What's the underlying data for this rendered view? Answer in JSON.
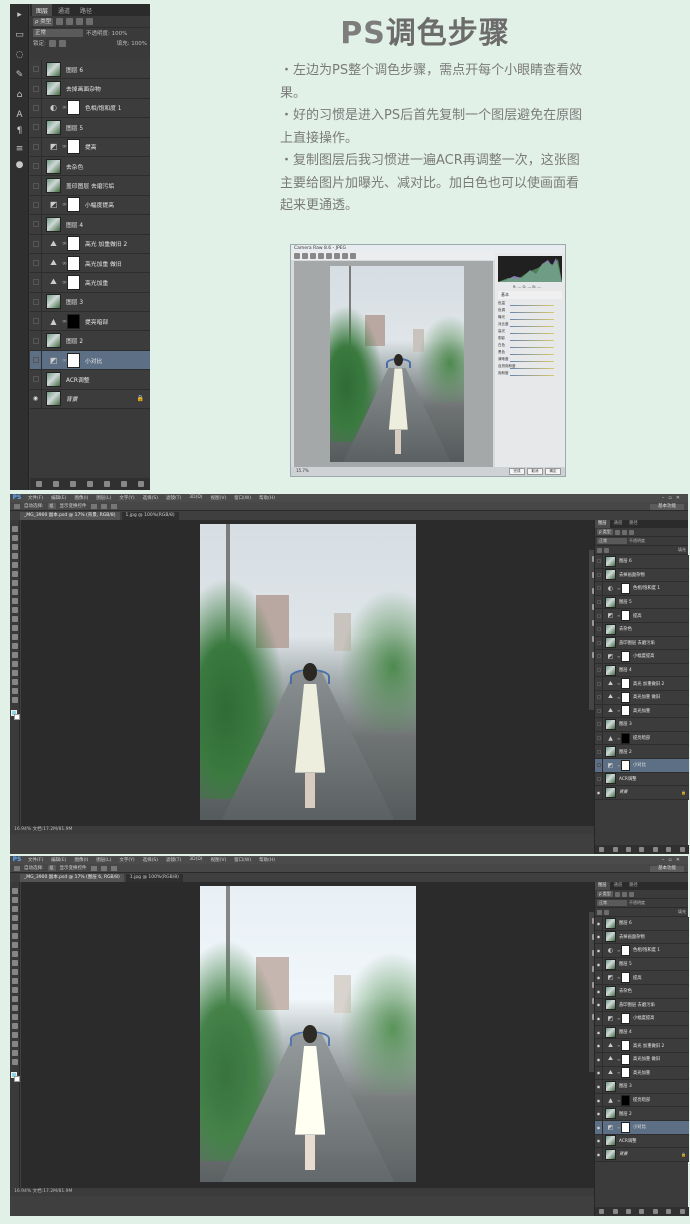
{
  "heading": {
    "ps": "PS",
    "rest": "调色步骤"
  },
  "notes": [
    "・左边为PS整个调色步骤，需点开每个小眼睛查看效果。",
    "・好的习惯是进入PS后首先复制一个图层避免在原图上直接操作。",
    "・复制图层后我习惯进一遍ACR再调整一次，这张图主要给图片加曝光、减对比。加白色也可以使画面看起来更通透。"
  ],
  "layers_panel": {
    "tabs": [
      "图层",
      "通道",
      "路径"
    ],
    "filter_label": "ρ 类型",
    "blend_mode": "正常",
    "opacity_label": "不透明度: 100%",
    "lock_label": "锁定:",
    "fill_label": "填充: 100%",
    "layers": [
      {
        "name": "图层 6",
        "kind": "pixel",
        "visible": false
      },
      {
        "name": "去掉画面杂物",
        "kind": "pixel",
        "visible": false
      },
      {
        "name": "色相/饱和度 1",
        "kind": "hue",
        "mask": "white",
        "visible": false
      },
      {
        "name": "图层 5",
        "kind": "pixel",
        "visible": false
      },
      {
        "name": "提高",
        "kind": "curves",
        "mask": "white",
        "visible": false
      },
      {
        "name": "去杂色",
        "kind": "pixel",
        "visible": false
      },
      {
        "name": "盖印图层 去磨污垢",
        "kind": "pixel",
        "visible": false
      },
      {
        "name": "小幅度提高",
        "kind": "curves",
        "mask": "white",
        "visible": false
      },
      {
        "name": "图层 4",
        "kind": "pixel",
        "visible": false
      },
      {
        "name": "高光 加重做旧 2",
        "kind": "levels",
        "mask": "white",
        "visible": false
      },
      {
        "name": "高光加重 做旧",
        "kind": "levels",
        "mask": "white",
        "visible": false
      },
      {
        "name": "高光加重",
        "kind": "levels",
        "mask": "white",
        "visible": false
      },
      {
        "name": "图层 3",
        "kind": "pixel",
        "visible": false
      },
      {
        "name": "提亮暗部",
        "kind": "levels2",
        "mask": "black",
        "visible": false
      },
      {
        "name": "图层 2",
        "kind": "pixel",
        "visible": false
      },
      {
        "name": "小对比",
        "kind": "curves",
        "mask": "white",
        "visible": false,
        "selected": true
      },
      {
        "name": "ACR调整",
        "kind": "pixel",
        "visible": false
      },
      {
        "name": "背景",
        "kind": "pixel",
        "visible": true,
        "locked": true,
        "italic": true
      }
    ]
  },
  "acr": {
    "title": "Camera Raw 8.6 - JPEG",
    "readout": "R: ---  G: ---  B: ---",
    "panel_title": "基本",
    "sliders": [
      "色温",
      "色调",
      "曝光",
      "对比度",
      "高光",
      "阴影",
      "白色",
      "黑色",
      "清晰度",
      "自然饱和度",
      "饱和度"
    ],
    "ok": "确定",
    "cancel": "取消",
    "done": "完成",
    "zoom": "15.7%"
  },
  "ps_screen_before": {
    "menus": [
      "文件(F)",
      "编辑(E)",
      "图像(I)",
      "图层(L)",
      "文字(Y)",
      "选择(S)",
      "滤镜(T)",
      "3D(D)",
      "视图(V)",
      "窗口(W)",
      "帮助(H)"
    ],
    "options": [
      "自动选择:",
      "组",
      "显示变换控件"
    ],
    "workspace": "基本功能",
    "doc_tab": "_MG_3900 副本.psd @ 17% (背景, RGB/8)",
    "doc_tab2": "1.jpg @ 100%(RGB/8)",
    "status": "16.94%   文档:17.2M/81.9M",
    "panel_tabs": [
      "图层",
      "通道",
      "路径"
    ],
    "blend_mode": "正常",
    "opacity_label": "不透明度",
    "fill_label": "填充"
  },
  "ps_screen_after": {
    "menus": [
      "文件(F)",
      "编辑(E)",
      "图像(I)",
      "图层(L)",
      "文字(Y)",
      "选择(S)",
      "滤镜(T)",
      "3D(D)",
      "视图(V)",
      "窗口(W)",
      "帮助(H)"
    ],
    "options": [
      "自动选择:",
      "组",
      "显示变换控件"
    ],
    "workspace": "基本功能",
    "doc_tab": "_MG_3900 副本.psd @ 17% (图层 6, RGB/8)",
    "doc_tab2": "1.jpg @ 100%(RGB/8)",
    "status": "16.94%   文档:17.2M/81.9M",
    "panel_tabs": [
      "图层",
      "通道",
      "路径"
    ],
    "blend_mode": "正常",
    "opacity_label": "不透明度",
    "fill_label": "填充"
  },
  "colors": {
    "background": "#e2f1e7",
    "ps_blue": "#5aa9ff",
    "selected_layer": "#5c6f84"
  },
  "icons": {
    "eye": "eye-icon",
    "lock": "lock-icon",
    "link": "chain-link-icon"
  }
}
